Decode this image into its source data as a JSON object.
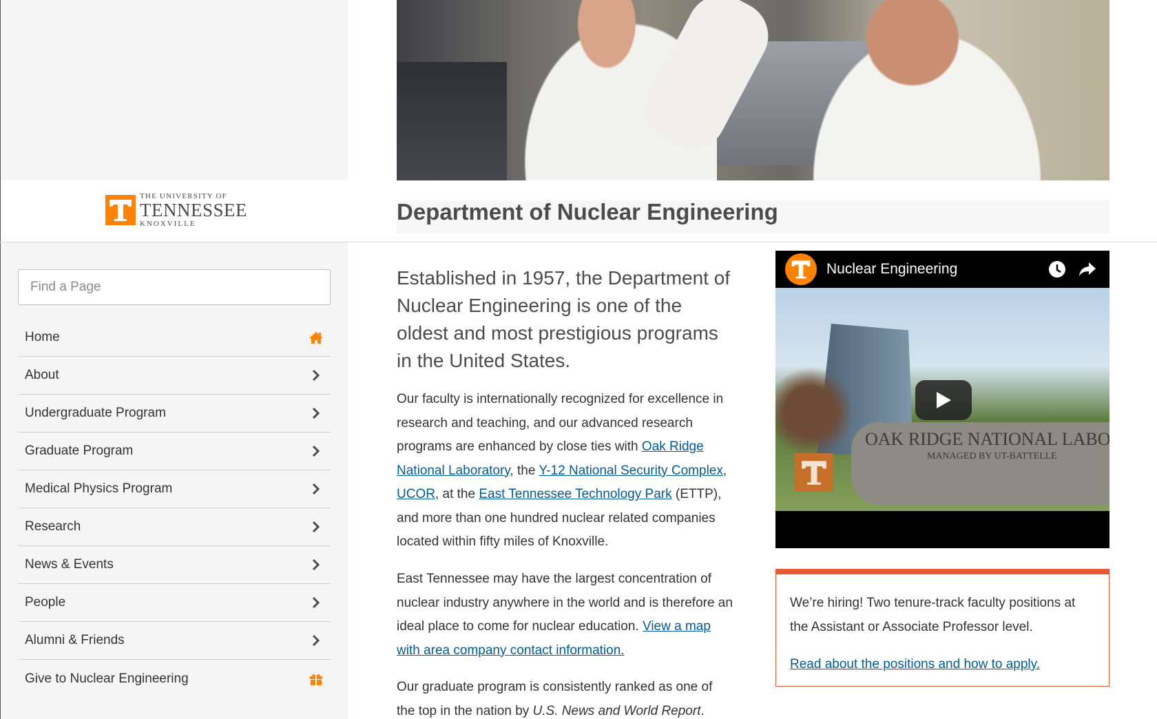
{
  "logo": {
    "line1": "THE UNIVERSITY OF",
    "line2": "TENNESSEE",
    "line3": "KNOXVILLE"
  },
  "search": {
    "placeholder": "Find a Page"
  },
  "nav": {
    "items": [
      {
        "label": "Home",
        "icon": "home-icon"
      },
      {
        "label": "About",
        "icon": "chevron-right-icon"
      },
      {
        "label": "Undergraduate Program",
        "icon": "chevron-right-icon"
      },
      {
        "label": "Graduate Program",
        "icon": "chevron-right-icon"
      },
      {
        "label": "Medical Physics Program",
        "icon": "chevron-right-icon"
      },
      {
        "label": "Research",
        "icon": "chevron-right-icon"
      },
      {
        "label": "News & Events",
        "icon": "chevron-right-icon"
      },
      {
        "label": "People",
        "icon": "chevron-right-icon"
      },
      {
        "label": "Alumni & Friends",
        "icon": "chevron-right-icon"
      },
      {
        "label": "Give to Nuclear Engineering",
        "icon": "gift-icon"
      }
    ]
  },
  "page": {
    "title": "Department of Nuclear Engineering",
    "intro": "Established in 1957, the Department of Nuclear Engineering is one of the oldest and most prestigious programs in the United States.",
    "p1": {
      "t1": "Our faculty is internationally recognized for excellence in research and teaching, and our advanced research programs are enhanced by close ties with ",
      "link1": "Oak Ridge National Laboratory",
      "t2": ", the ",
      "link2": "Y-12 National Security Complex",
      "t3": ", ",
      "link3": "UCOR",
      "t4": ", at the ",
      "link4": "East Tennessee Technology Park",
      "t5": " (ETTP), and more than one hundred nuclear related companies located within fifty miles of Knoxville."
    },
    "p2": {
      "t1": "East Tennessee may have the largest concentration of nuclear industry anywhere in the world and is therefore an ideal place to come for nuclear education. ",
      "link1": "View a map with area company contact information."
    },
    "p3": {
      "t1": "Our graduate program is consistently ranked as one of the top in the nation by ",
      "em": "U.S. News and World Report",
      "t2": "."
    }
  },
  "video": {
    "channel_title": "Nuclear Engineering",
    "sign_text": "OAK RIDGE NATIONAL LABORA",
    "sign_sub": "MANAGED BY UT-BATTELLE"
  },
  "hiring": {
    "text": "We’re hiring! Two tenure-track faculty positions at the Assistant or Associate Professor level.",
    "link": "Read about the positions and how to apply."
  },
  "colors": {
    "brand_orange": "#ff8200",
    "accent_red": "#e65933",
    "link": "#005b96"
  }
}
